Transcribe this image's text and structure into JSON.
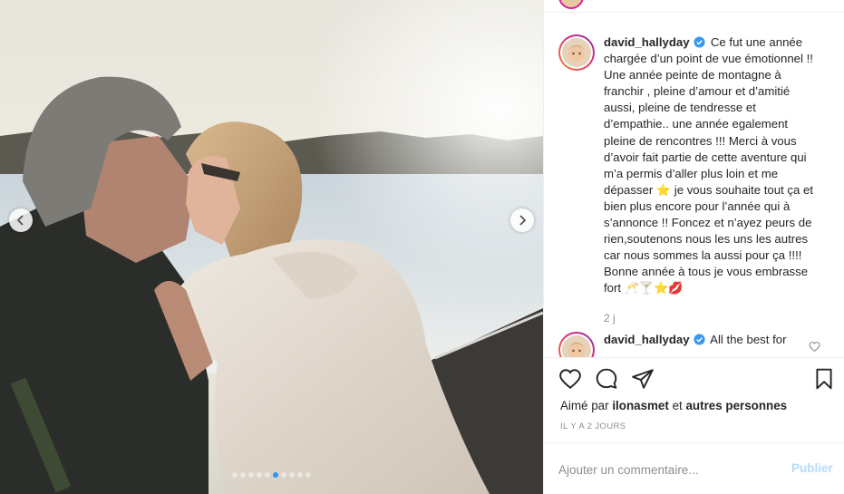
{
  "post": {
    "photo": {
      "prev_icon": "chevron-left-icon",
      "next_icon": "chevron-right-icon",
      "slide_count": 10,
      "active_slide": 6
    },
    "caption": {
      "username": "david_hallyday",
      "verified_icon": "verified-badge-icon",
      "text": "Ce fut une année chargée d’un point de vue émotionnel !! Une année peinte de montagne à franchir , pleine d’amour et d’amitié aussi, pleine de tendresse et d’empathie.. une année egalement pleine de rencontres !!! Merci à vous d’avoir fait partie de cette aventure qui m’a permis d’aller plus loin et me dépasser ",
      "text_emoji_1": "⭐",
      "text_2": " je vous souhaite tout ça et bien plus encore pour l’année qui à s’annonce !! Foncez et n’ayez peurs de rien,soutenons nous les uns les autres car nous sommes la aussi pour ça !!!! Bonne année à tous je vous embrasse fort ",
      "end_emojis": [
        "🥂",
        "🍸",
        "⭐",
        "💋"
      ],
      "time": "2 j"
    },
    "reply": {
      "username": "david_hallyday",
      "text": "All the best for",
      "like_icon": "heart-outline-icon"
    },
    "actions": {
      "like_icon": "heart-outline-icon",
      "comment_icon": "speech-bubble-icon",
      "share_icon": "paper-plane-icon",
      "save_icon": "bookmark-icon"
    },
    "likes": {
      "prefix": "Aimé par",
      "user": "ilonasmet",
      "connector": "et",
      "others": "autres personnes"
    },
    "posted": "IL Y A 2 JOURS",
    "comment_box": {
      "placeholder": "Ajouter un commentaire...",
      "value": "",
      "publish_label": "Publier"
    }
  },
  "colors": {
    "accent": "#0095f6",
    "publish_disabled": "#b3dbff",
    "verified": "#3897f0",
    "muted": "#8e8e8e",
    "border": "#efefef",
    "text": "#262626"
  }
}
